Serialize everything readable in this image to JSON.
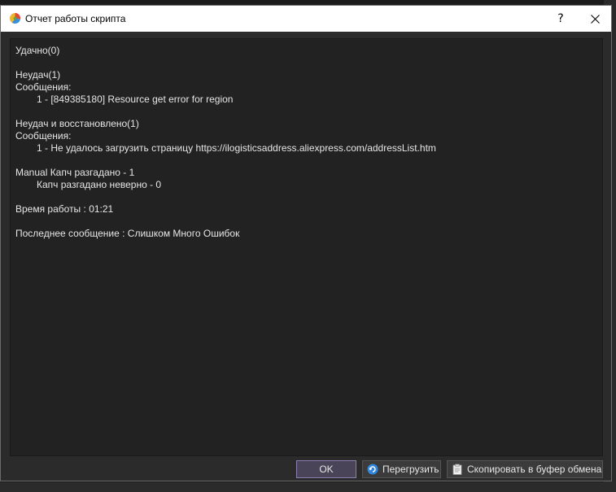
{
  "window": {
    "title": "Отчет работы скрипта",
    "help_label": "?"
  },
  "report": {
    "lines": [
      {
        "text": "Удачно(0)",
        "indent": false
      },
      {
        "text": "",
        "indent": false
      },
      {
        "text": "Неудач(1)",
        "indent": false
      },
      {
        "text": "Сообщения:",
        "indent": false
      },
      {
        "text": "1 - [849385180] Resource get error for region",
        "indent": true
      },
      {
        "text": "",
        "indent": false
      },
      {
        "text": "Неудач и восстановлено(1)",
        "indent": false
      },
      {
        "text": "Сообщения:",
        "indent": false
      },
      {
        "text": "1 - Не удалось загрузить страницу https://ilogisticsaddress.aliexpress.com/addressList.htm",
        "indent": true
      },
      {
        "text": "",
        "indent": false
      },
      {
        "text": "Manual Капч разгадано - 1",
        "indent": false
      },
      {
        "text": "Капч разгадано неверно - 0",
        "indent": true
      },
      {
        "text": "",
        "indent": false
      },
      {
        "text": "Время работы : 01:21",
        "indent": false
      },
      {
        "text": "",
        "indent": false
      },
      {
        "text": "Последнее сообщение : Слишком Много Ошибок",
        "indent": false
      }
    ]
  },
  "buttons": {
    "ok": "OK",
    "reload": "Перегрузить",
    "copy": "Скопировать в буфер обмена"
  },
  "icons": {
    "app": "pie-chart-icon",
    "reload": "refresh-icon",
    "copy": "clipboard-icon",
    "close": "close-icon"
  },
  "colors": {
    "content_bg": "#222222",
    "text": "#e6e6e6",
    "ok_border": "#8a7fb0"
  }
}
